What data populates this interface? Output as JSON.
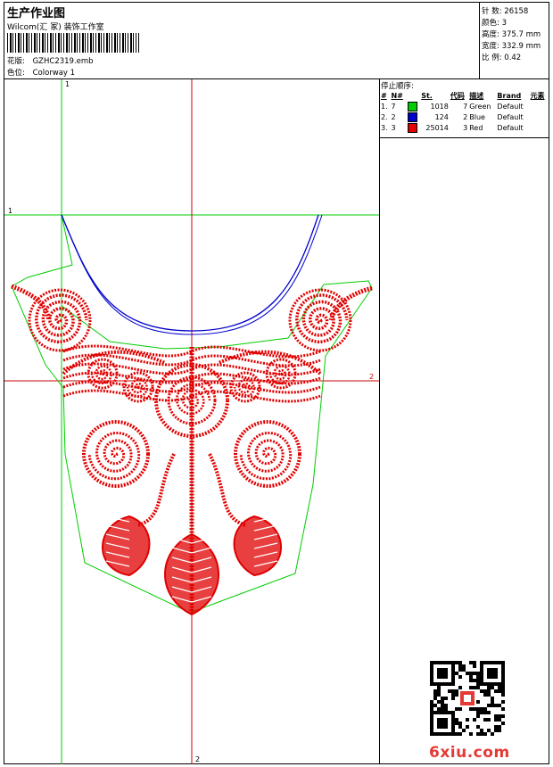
{
  "header": {
    "title": "生产作业图",
    "company": "Wilcom(汇 冢) 装饰工作室",
    "design_label": "花版:",
    "design_value": "GZHC2319.emb",
    "colorway_label": "色位:",
    "colorway_value": "Colorway 1"
  },
  "stats": {
    "stitches_label": "针 数:",
    "stitches_value": "26158",
    "colors_label": "颜色:",
    "colors_value": "3",
    "height_label": "高度:",
    "height_value": "375.7 mm",
    "width_label": "宽度:",
    "width_value": "332.9 mm",
    "scale_label": "比 例:",
    "scale_value": "0.42"
  },
  "stop_sequence": {
    "title": "停止顺序:",
    "headers": [
      "#",
      "N#",
      "",
      "St.",
      "代码",
      "描述",
      "Brand",
      "元素"
    ],
    "rows": [
      {
        "num": "1.",
        "n": "7",
        "color": "#00cc00",
        "st": "1018",
        "code": "7",
        "desc": "Green",
        "brand": "Default"
      },
      {
        "num": "2.",
        "n": "2",
        "color": "#0000cc",
        "st": "124",
        "code": "2",
        "desc": "Blue",
        "brand": "Default"
      },
      {
        "num": "3.",
        "n": "3",
        "color": "#e00000",
        "st": "25014",
        "code": "3",
        "desc": "Red",
        "brand": "Default"
      }
    ]
  },
  "crosshair_labels": {
    "top": "1",
    "left": "1",
    "right": "2",
    "bottom": "2"
  },
  "watermark": "6xiu.com",
  "colors": {
    "green": "#00cc00",
    "blue": "#0000cc",
    "red": "#e00000",
    "guide": "#cc0000"
  }
}
